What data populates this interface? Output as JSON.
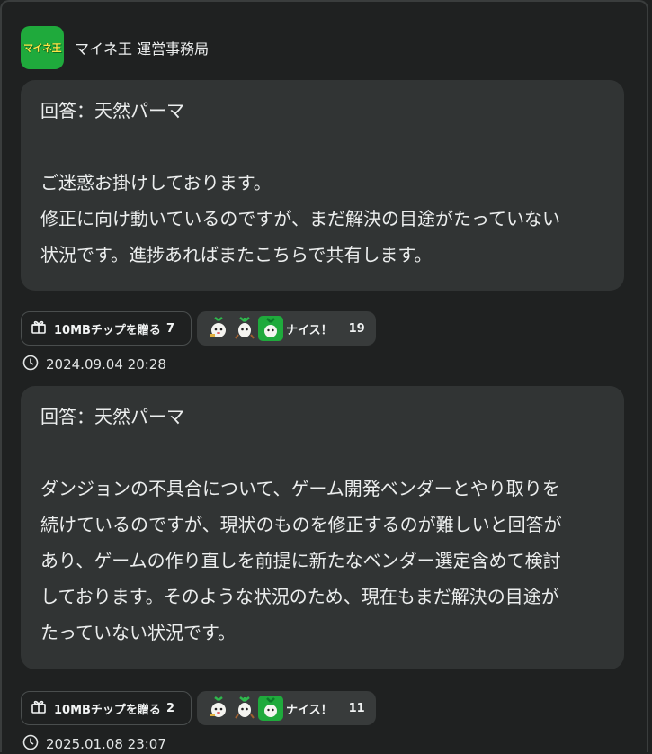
{
  "header": {
    "logo_text": "マイネ王",
    "sender": "マイネ王 運営事務局"
  },
  "posts": [
    {
      "body": "回答：天然パーマ\n\nご迷惑お掛けしております。\n修正に向け動いているのですが、まだ解決の目途がたっていない\n状況です。進捗あればまたこちらで共有します。",
      "tip_label": "10MBチップを贈る",
      "tip_count": "7",
      "nice_label": "ナイス！",
      "nice_count": "19",
      "timestamp": "2024.09.04 20:28"
    },
    {
      "body": "回答：天然パーマ\n\nダンジョンの不具合について、ゲーム開発ベンダーとやり取りを\n続けているのですが、現状のものを修正するのが難しいと回答が\nあり、ゲームの作り直しを前提に新たなベンダー選定含めて検討\nしております。そのような状況のため、現在もまだ解決の目途が\nたっていない状況です。",
      "tip_label": "10MBチップを贈る",
      "tip_count": "2",
      "nice_label": "ナイス！",
      "nice_count": "11",
      "timestamp": "2025.01.08 23:07"
    }
  ],
  "icons": {
    "tip": "gift-icon",
    "time": "clock-icon",
    "reactor": "radish-mascot-icon"
  },
  "colors": {
    "background": "#1f2121",
    "bubble": "#313434",
    "brand_green": "#1faa3c"
  }
}
